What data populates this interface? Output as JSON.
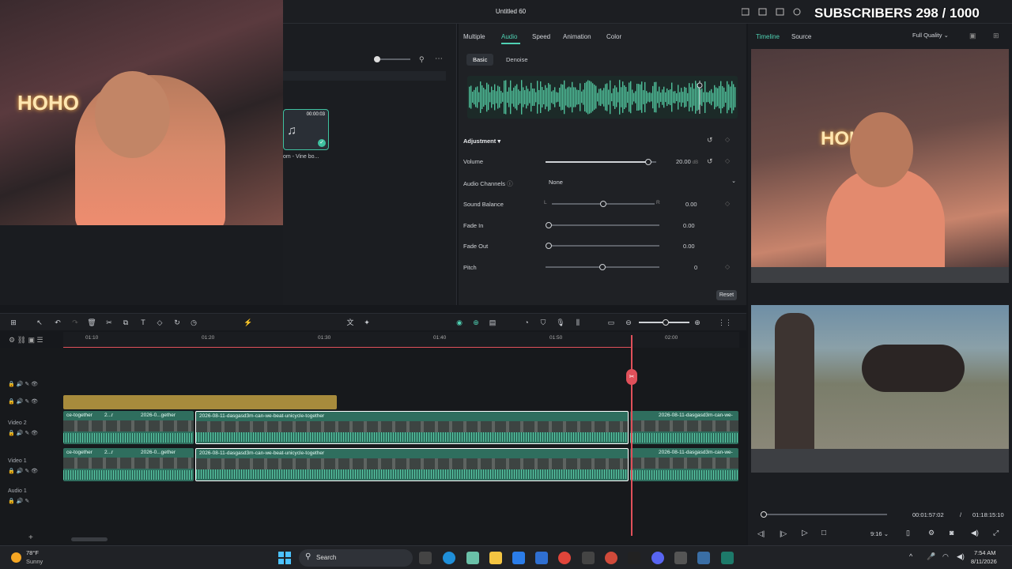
{
  "window": {
    "title": "Untitled 60"
  },
  "overlay": {
    "subscribers": "SUBSCRIBERS 298 / 1000"
  },
  "webcam": {
    "neon_text": "HOHO"
  },
  "media": {
    "clip_duration": "00:00:03",
    "clip_name": "om - Vine bo..."
  },
  "props": {
    "tabs": [
      "Multiple",
      "Audio",
      "Speed",
      "Animation",
      "Color"
    ],
    "active_tab": "Audio",
    "subtabs": [
      "Basic",
      "Denoise"
    ],
    "adjustment_label": "Adjustment",
    "volume": {
      "label": "Volume",
      "value": "20.00",
      "unit": "dB",
      "level": 0.93
    },
    "audio_channels": {
      "label": "Audio Channels",
      "value": "None"
    },
    "sound_balance": {
      "label": "Sound Balance",
      "left": "L",
      "right": "R",
      "value": "0.00",
      "level": 0.5
    },
    "fade_in": {
      "label": "Fade In",
      "value": "0.00",
      "level": 0
    },
    "fade_out": {
      "label": "Fade Out",
      "value": "0.00",
      "level": 0
    },
    "pitch": {
      "label": "Pitch",
      "value": "0",
      "level": 0.5
    },
    "reset_label": "Reset"
  },
  "preview": {
    "tabs": [
      "Timeline",
      "Source"
    ],
    "quality": "Full Quality",
    "current_time": "00:01:57:02",
    "separator": "/",
    "total_time": "01:18:15:10",
    "aspect": "9:16"
  },
  "ruler": {
    "ticks": [
      "01:10",
      "01:20",
      "01:30",
      "01:40",
      "01:50",
      "02:00"
    ]
  },
  "tracks": {
    "video2": "Video 2",
    "video1": "Video 1",
    "audio1": "Audio 1",
    "clip_left_a": "ce-together",
    "clip_left_b": "2...r",
    "clip_left_c": "2026-0...gether",
    "clip_main": "2026-08-11-dasgasd3m-can-we-beat-unicycle-together",
    "clip_right": "2026-08-11-dasgasd3m-can-we-"
  },
  "taskbar": {
    "weather_temp": "78°F",
    "weather_desc": "Sunny",
    "search": "Search",
    "time": "7:54 AM",
    "date": "8/11/2026"
  }
}
